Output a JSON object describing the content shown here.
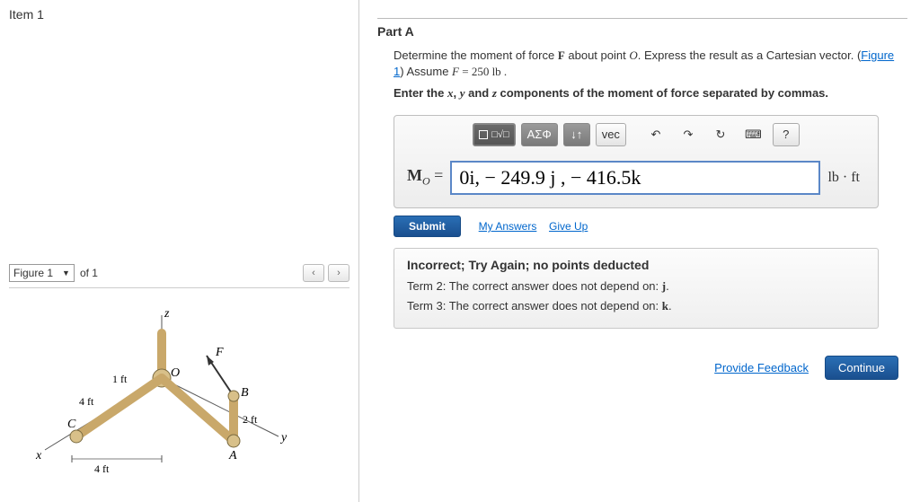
{
  "left": {
    "item_title": "Item 1",
    "figure_select_label": "Figure 1",
    "figure_of": "of 1",
    "nav_prev_glyph": "‹",
    "nav_next_glyph": "›",
    "diagram": {
      "axis_z": "z",
      "axis_y": "y",
      "axis_x": "x",
      "pt_O": "O",
      "pt_A": "A",
      "pt_B": "B",
      "pt_C": "C",
      "force_F": "F",
      "len_1ft": "1 ft",
      "len_2ft": "2 ft",
      "len_4ft_a": "4 ft",
      "len_4ft_b": "4 ft"
    }
  },
  "right": {
    "part_label": "Part A",
    "prompt_pre": "Determine the moment of force ",
    "prompt_F": "F",
    "prompt_mid": " about point ",
    "prompt_O": "O",
    "prompt_post": ". Express the result as a Cartesian vector. (",
    "figure_link": "Figure 1",
    "prompt_close": ") Assume ",
    "assume_F": "F",
    "assume_eq": " = 250 lb .",
    "enter_pre": "Enter the ",
    "enter_x": "x",
    "enter_comma1": ", ",
    "enter_y": "y",
    "enter_and": " and ",
    "enter_z": "z",
    "enter_post": " components of the moment of force separated by commas.",
    "toolbar": {
      "template": "□√□",
      "greek": "ΑΣΦ",
      "scripts": "↓↑",
      "vec": "vec",
      "undo": "↶",
      "redo": "↷",
      "reset": "↻",
      "keyboard": "⌨",
      "help": "?"
    },
    "mo_label_M": "M",
    "mo_label_O": "O",
    "mo_eq": " = ",
    "answer_value": "0i, − 249.9 j , − 416.5k",
    "unit": "lb · ft",
    "submit": "Submit",
    "my_answers": "My Answers",
    "give_up": "Give Up",
    "feedback": {
      "title": "Incorrect; Try Again; no points deducted",
      "line2_pre": "Term 2: The correct answer does not depend on: ",
      "line2_var": "j",
      "line2_post": ".",
      "line3_pre": "Term 3: The correct answer does not depend on: ",
      "line3_var": "k",
      "line3_post": "."
    },
    "provide_feedback": "Provide Feedback",
    "continue": "Continue"
  }
}
